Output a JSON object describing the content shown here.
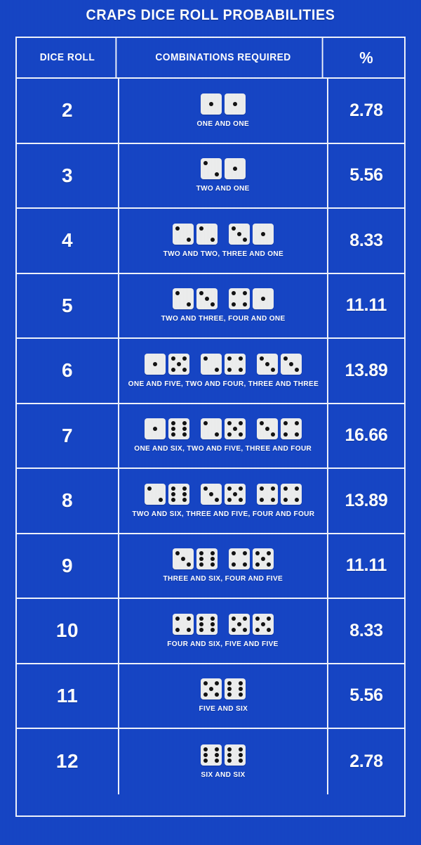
{
  "title": "CRAPS DICE ROLL PROBABILITIES",
  "colors": {
    "background": "#1544c4",
    "grid_line": "#eef2fb",
    "text": "#ffffff",
    "die_face": "#eceded",
    "die_pip": "#111111"
  },
  "table": {
    "headers": {
      "roll": "DICE ROLL",
      "combinations": "COMBINATIONS REQUIRED",
      "percent": "%"
    },
    "rows": [
      {
        "roll": "2",
        "percent": "2.78",
        "label": "ONE AND ONE",
        "pairs": [
          [
            1,
            1
          ]
        ]
      },
      {
        "roll": "3",
        "percent": "5.56",
        "label": "TWO AND ONE",
        "pairs": [
          [
            2,
            1
          ]
        ]
      },
      {
        "roll": "4",
        "percent": "8.33",
        "label": "TWO AND TWO, THREE AND ONE",
        "pairs": [
          [
            2,
            2
          ],
          [
            3,
            1
          ]
        ]
      },
      {
        "roll": "5",
        "percent": "11.11",
        "label": "TWO AND THREE, FOUR AND ONE",
        "pairs": [
          [
            2,
            3
          ],
          [
            4,
            1
          ]
        ]
      },
      {
        "roll": "6",
        "percent": "13.89",
        "label": "ONE AND FIVE, TWO AND FOUR, THREE AND THREE",
        "pairs": [
          [
            1,
            5
          ],
          [
            2,
            4
          ],
          [
            3,
            3
          ]
        ]
      },
      {
        "roll": "7",
        "percent": "16.66",
        "label": "ONE AND SIX, TWO AND FIVE, THREE AND FOUR",
        "pairs": [
          [
            1,
            6
          ],
          [
            2,
            5
          ],
          [
            3,
            4
          ]
        ]
      },
      {
        "roll": "8",
        "percent": "13.89",
        "label": "TWO AND SIX, THREE AND FIVE, FOUR AND FOUR",
        "pairs": [
          [
            2,
            6
          ],
          [
            3,
            5
          ],
          [
            4,
            4
          ]
        ]
      },
      {
        "roll": "9",
        "percent": "11.11",
        "label": "THREE AND SIX, FOUR AND FIVE",
        "pairs": [
          [
            3,
            6
          ],
          [
            4,
            5
          ]
        ]
      },
      {
        "roll": "10",
        "percent": "8.33",
        "label": "FOUR AND SIX, FIVE AND FIVE",
        "pairs": [
          [
            4,
            6
          ],
          [
            5,
            5
          ]
        ]
      },
      {
        "roll": "11",
        "percent": "5.56",
        "label": "FIVE AND SIX",
        "pairs": [
          [
            5,
            6
          ]
        ]
      },
      {
        "roll": "12",
        "percent": "2.78",
        "label": "SIX AND SIX",
        "pairs": [
          [
            6,
            6
          ]
        ]
      }
    ]
  },
  "chart_data": {
    "type": "table",
    "title": "CRAPS DICE ROLL PROBABILITIES",
    "columns": [
      "DICE ROLL",
      "COMBINATIONS REQUIRED",
      "%"
    ],
    "categories": [
      "2",
      "3",
      "4",
      "5",
      "6",
      "7",
      "8",
      "9",
      "10",
      "11",
      "12"
    ],
    "values": [
      2.78,
      5.56,
      8.33,
      11.11,
      13.89,
      16.66,
      13.89,
      11.11,
      8.33,
      5.56,
      2.78
    ],
    "xlabel": "Dice Roll",
    "ylabel": "%",
    "ylim": [
      0,
      20
    ],
    "combinations": [
      "ONE AND ONE",
      "TWO AND ONE",
      "TWO AND TWO, THREE AND ONE",
      "TWO AND THREE, FOUR AND ONE",
      "ONE AND FIVE, TWO AND FOUR, THREE AND THREE",
      "ONE AND SIX, TWO AND FIVE, THREE AND FOUR",
      "TWO AND SIX, THREE AND FIVE, FOUR AND FOUR",
      "THREE AND SIX, FOUR AND FIVE",
      "FOUR AND SIX, FIVE AND FIVE",
      "FIVE AND SIX",
      "SIX AND SIX"
    ]
  }
}
